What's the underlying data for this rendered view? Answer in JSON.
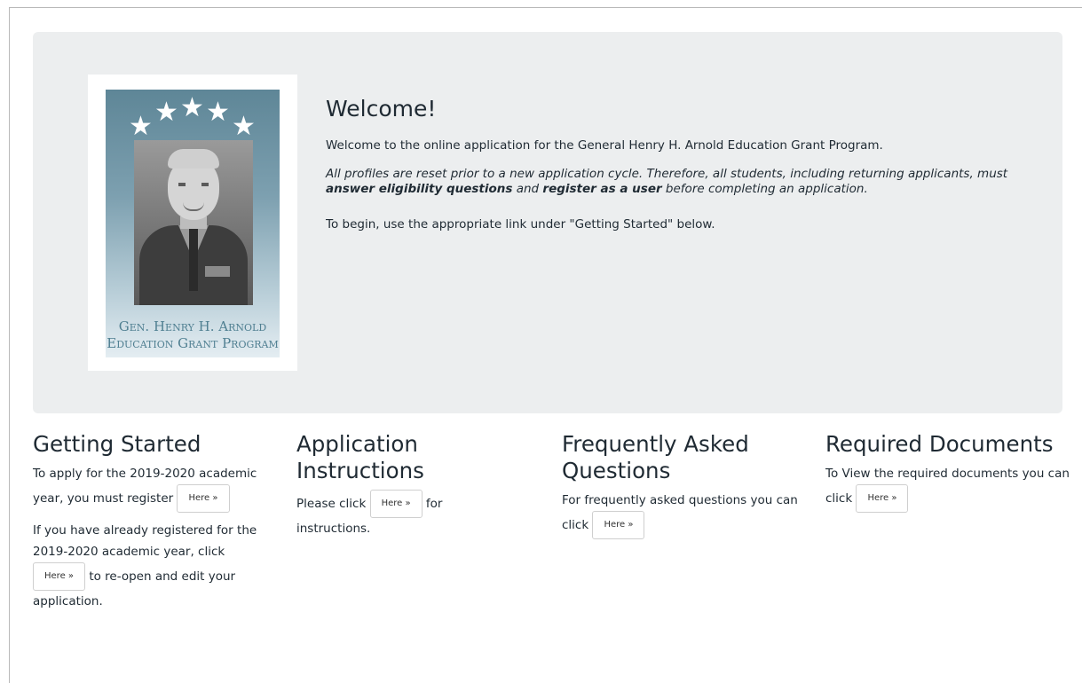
{
  "jumbotron": {
    "portrait": {
      "caption_line1": "Gen. Henry H. Arnold",
      "caption_line2": "Education Grant Program",
      "stars": [
        "★",
        "★",
        "★",
        "★",
        "★"
      ]
    },
    "title": "Welcome!",
    "intro": "Welcome to the online application for the General Henry H. Arnold Education Grant Program.",
    "notice_part1": "All profiles are reset prior to a new application cycle. Therefore, all students, including returning applicants, must ",
    "notice_bold1": "answer eligibility questions",
    "notice_part2": " and ",
    "notice_bold2": "register as a user",
    "notice_part3": " before completing an application.",
    "begin": "To begin, use the appropriate link under \"Getting Started\" below."
  },
  "sections": {
    "getting_started": {
      "title": "Getting Started",
      "p1_text": "To apply for the 2019-2020 academic year, you must register",
      "p1_button": "Here »",
      "p2_text_before": "If you have already registered for the 2019-2020 academic year, click",
      "p2_button": "Here »",
      "p2_text_after": "to re-open and edit your application."
    },
    "application_instructions": {
      "title": "Application Instructions",
      "text_before": "Please click",
      "button": "Here »",
      "text_after": "for instructions."
    },
    "faq": {
      "title": "Frequently Asked Questions",
      "text": "For frequently asked questions you can click",
      "button": "Here »"
    },
    "required_documents": {
      "title": "Required Documents",
      "text": "To View the required documents you can click",
      "button": "Here »"
    }
  },
  "colors": {
    "jumbotron_bg": "#eceeef",
    "heading_text": "#1f2a33",
    "caption_text": "#4f7f91"
  }
}
